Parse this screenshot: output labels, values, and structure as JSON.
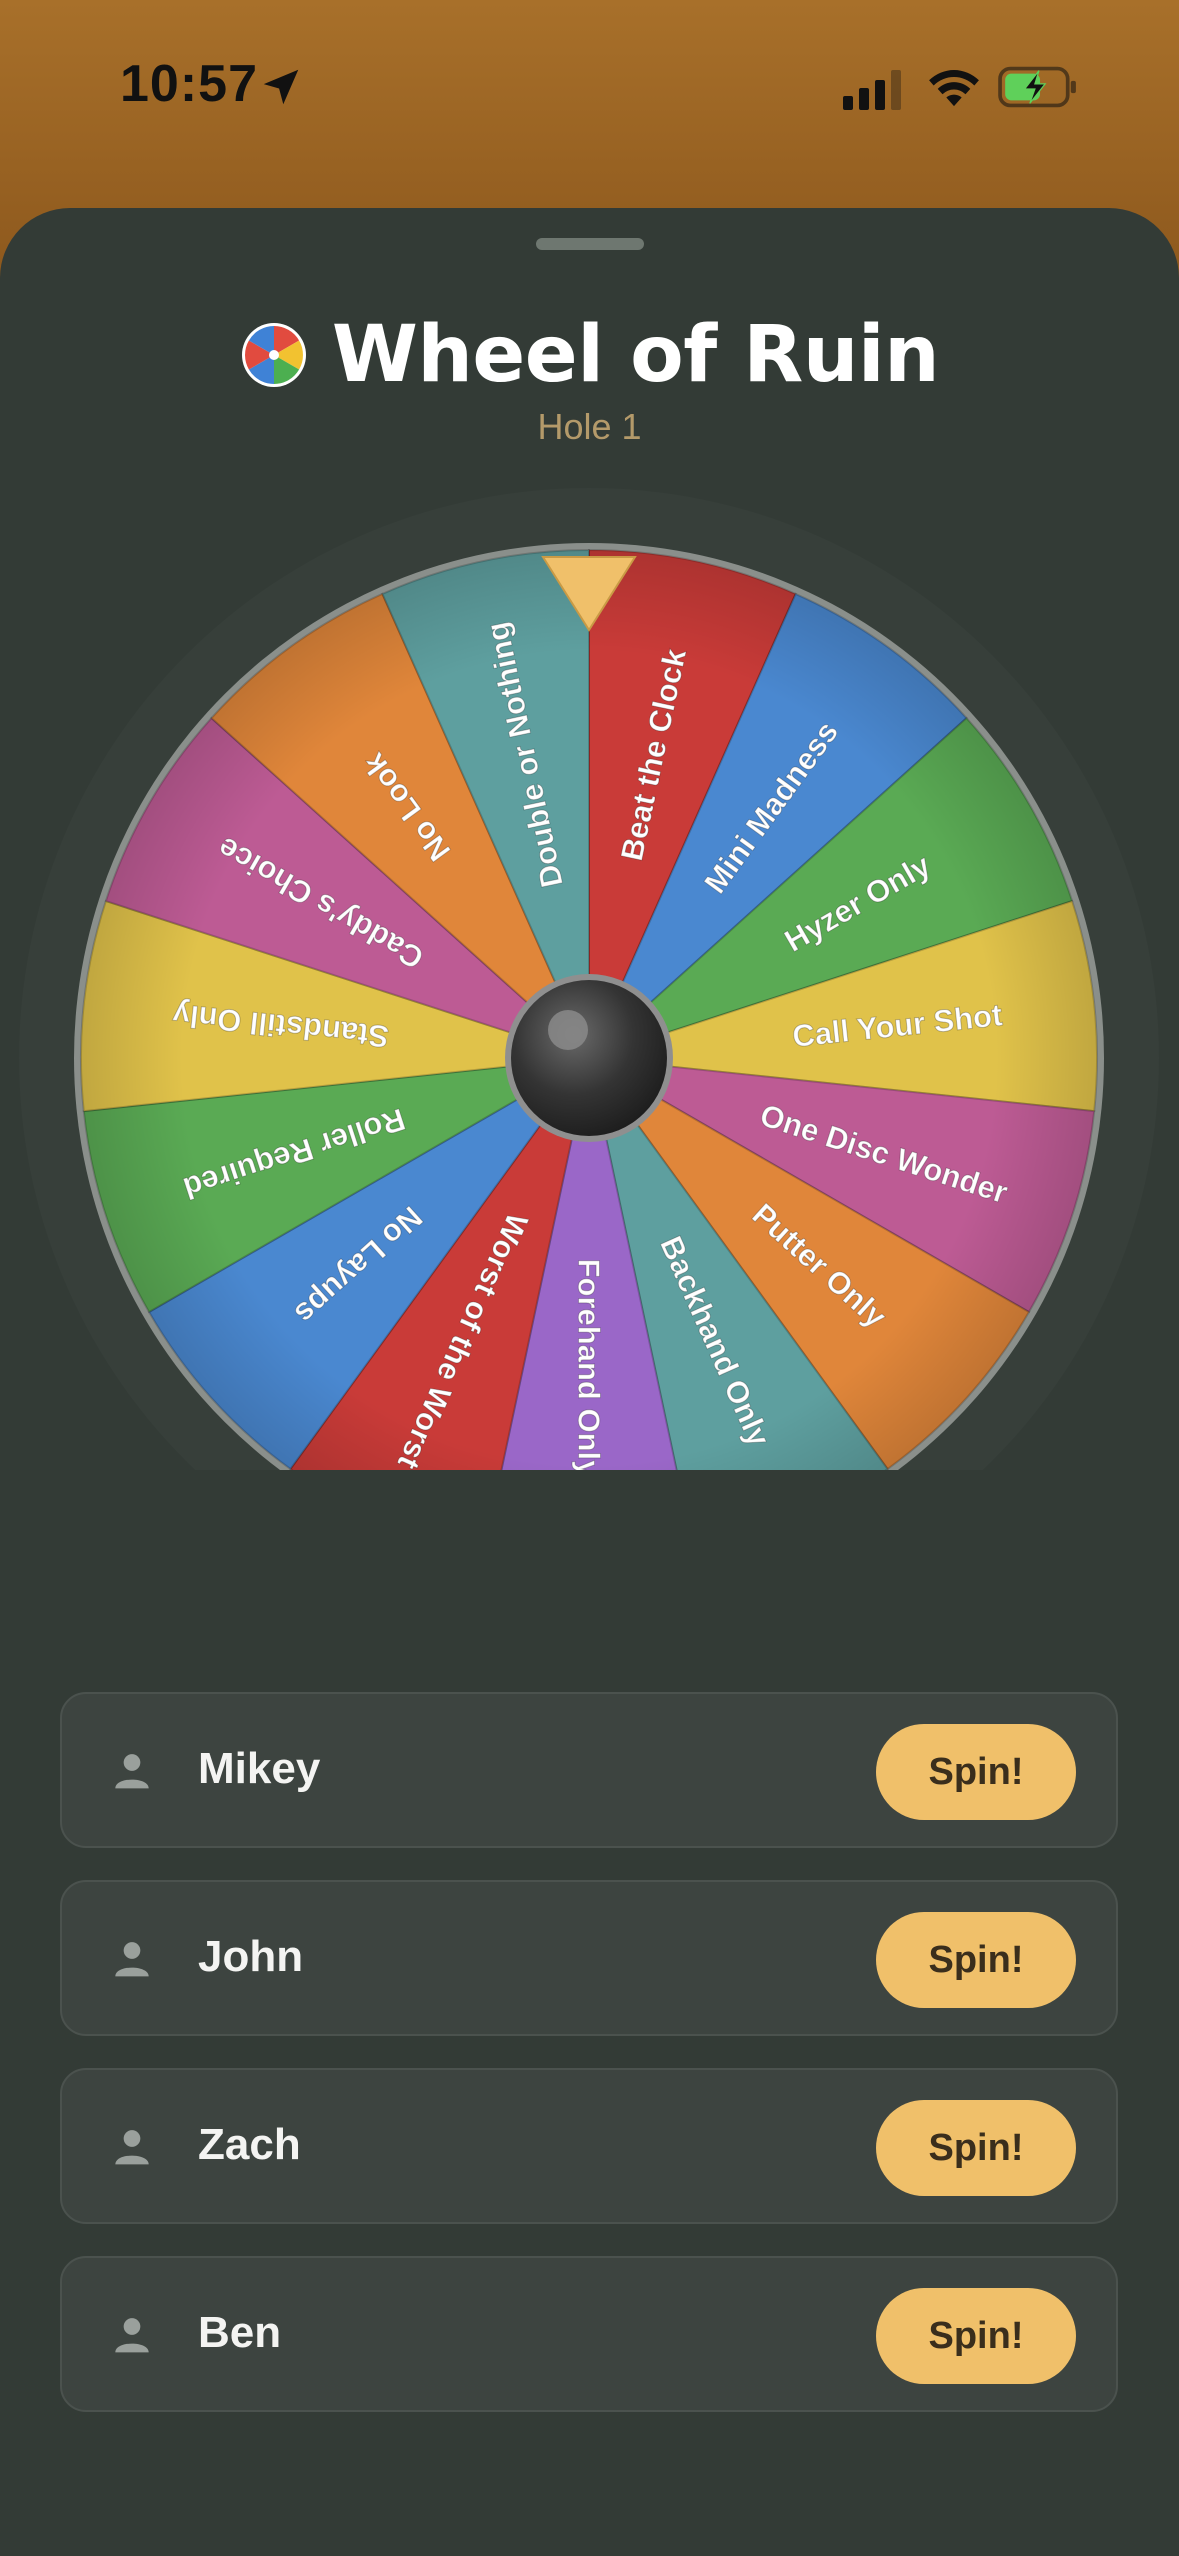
{
  "status": {
    "time": "10:57",
    "icons": [
      "location-arrow-icon",
      "cellular-signal-icon",
      "wifi-icon",
      "battery-charging-icon"
    ]
  },
  "app": {
    "title": "Wheel of Ruin",
    "subtitle": "Hole 1",
    "title_icon": "color-wheel-icon"
  },
  "wheel": {
    "segments": [
      {
        "label": "Beat the Clock",
        "color": "#c93b38"
      },
      {
        "label": "Mini Madness",
        "color": "#4a88d0"
      },
      {
        "label": "Hyzer Only",
        "color": "#5aaa54"
      },
      {
        "label": "Call Your Shot",
        "color": "#e0c24a"
      },
      {
        "label": "One Disc Wonder",
        "color": "#bd5b94"
      },
      {
        "label": "Putter Only",
        "color": "#e0863a"
      },
      {
        "label": "Backhand Only",
        "color": "#5e9f9f"
      },
      {
        "label": "Forehand Only",
        "color": "#9a67c8"
      },
      {
        "label": "Worst of the Worst",
        "color": "#c93b38"
      },
      {
        "label": "No Layups",
        "color": "#4a88d0"
      },
      {
        "label": "Roller Required",
        "color": "#5aaa54"
      },
      {
        "label": "Standstill Only",
        "color": "#e0c24a"
      },
      {
        "label": "Caddy's Choice",
        "color": "#bd5b94"
      },
      {
        "label": "No Look",
        "color": "#e0863a"
      },
      {
        "label": "Double or Nothing",
        "color": "#5e9f9f"
      }
    ],
    "pointer_color": "#f0c06a",
    "hub_icon": "spin-hub-icon"
  },
  "players": [
    {
      "name": "Mikey",
      "button": "Spin!"
    },
    {
      "name": "John",
      "button": "Spin!"
    },
    {
      "name": "Zach",
      "button": "Spin!"
    },
    {
      "name": "Ben",
      "button": "Spin!"
    }
  ],
  "colors": {
    "accent": "#f0c06a",
    "sheet": "#333b36",
    "card": "#3d4440",
    "subtitle": "#b49a6a"
  }
}
